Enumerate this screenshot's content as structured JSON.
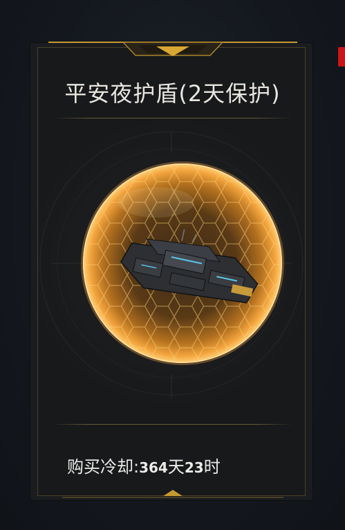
{
  "item": {
    "title": "平安夜护盾(2天保护)",
    "cooldown_label": "购买冷却:",
    "cooldown_days": "364",
    "cooldown_days_unit": "天",
    "cooldown_hours": "23",
    "cooldown_hours_unit": "时",
    "image_icon": "shield-dome-warship-icon"
  },
  "colors": {
    "gold_accent": "#e0b23a",
    "frame_border": "#4b4129",
    "shield_orange": "#f0a340",
    "side_tab_red": "#c8161b"
  }
}
